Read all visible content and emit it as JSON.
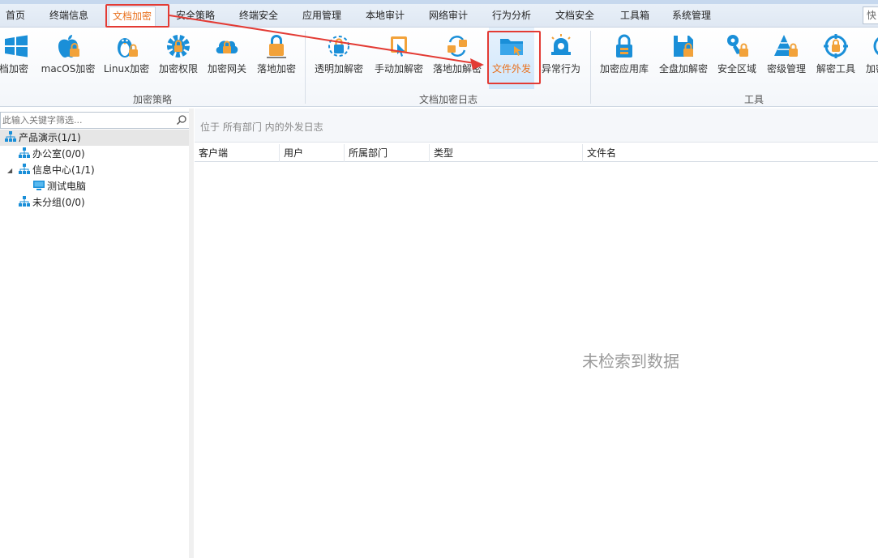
{
  "menu": {
    "tabs": [
      {
        "label": "首页"
      },
      {
        "label": "终端信息"
      },
      {
        "label": "文档加密"
      },
      {
        "label": "安全策略"
      },
      {
        "label": "终端安全"
      },
      {
        "label": "应用管理"
      },
      {
        "label": "本地审计"
      },
      {
        "label": "网络审计"
      },
      {
        "label": "行为分析"
      },
      {
        "label": "文档安全"
      },
      {
        "label": "工具箱"
      },
      {
        "label": "系统管理"
      }
    ],
    "active_tab": "文档加密",
    "quick_search_label": "快"
  },
  "ribbon": {
    "groups": [
      {
        "label": "加密策略"
      },
      {
        "label": "文档加密日志"
      },
      {
        "label": "工具"
      }
    ],
    "buttons": [
      {
        "label": "文档加密",
        "icon": "windows-icon"
      },
      {
        "label": "macOS加密",
        "icon": "apple-icon"
      },
      {
        "label": "Linux加密",
        "icon": "linux-icon"
      },
      {
        "label": "加密权限",
        "icon": "gear-lock-icon"
      },
      {
        "label": "加密网关",
        "icon": "cloud-lock-icon"
      },
      {
        "label": "落地加密",
        "icon": "lock-icon"
      },
      {
        "label": "透明加解密",
        "icon": "transparent-crypt-icon"
      },
      {
        "label": "手动加解密",
        "icon": "manual-crypt-icon"
      },
      {
        "label": "落地加解密",
        "icon": "landing-crypt-icon"
      },
      {
        "label": "文件外发",
        "icon": "folder-send-icon"
      },
      {
        "label": "异常行为",
        "icon": "alarm-icon"
      },
      {
        "label": "加密应用库",
        "icon": "app-lock-icon"
      },
      {
        "label": "全盘加解密",
        "icon": "disk-lock-icon"
      },
      {
        "label": "安全区域",
        "icon": "key-lock-icon"
      },
      {
        "label": "密级管理",
        "icon": "pyramid-lock-icon"
      },
      {
        "label": "解密工具",
        "icon": "decrypt-tool-icon"
      },
      {
        "label": "加密",
        "icon": "more-icon"
      }
    ],
    "selected_button": "文件外发"
  },
  "tree": {
    "filter_placeholder": "此输入关键字筛选...",
    "nodes": [
      {
        "label": "产品演示(1/1)",
        "icon": "org-icon",
        "selected": true
      },
      {
        "label": "办公室(0/0)",
        "icon": "org-icon"
      },
      {
        "label": "信息中心(1/1)",
        "icon": "org-icon",
        "expanded": true
      },
      {
        "label": "测试电脑",
        "icon": "computer-icon"
      },
      {
        "label": "未分组(0/0)",
        "icon": "org-icon"
      }
    ]
  },
  "content": {
    "location_text": "位于 所有部门 内的外发日志",
    "columns": [
      "客户端",
      "用户",
      "所属部门",
      "类型",
      "文件名"
    ],
    "empty_text": "未检索到数据"
  },
  "colors": {
    "accent": "#e8711f",
    "highlight_border": "#e33b34",
    "icon_blue": "#1a8fd8",
    "icon_orange": "#f2a23a"
  }
}
